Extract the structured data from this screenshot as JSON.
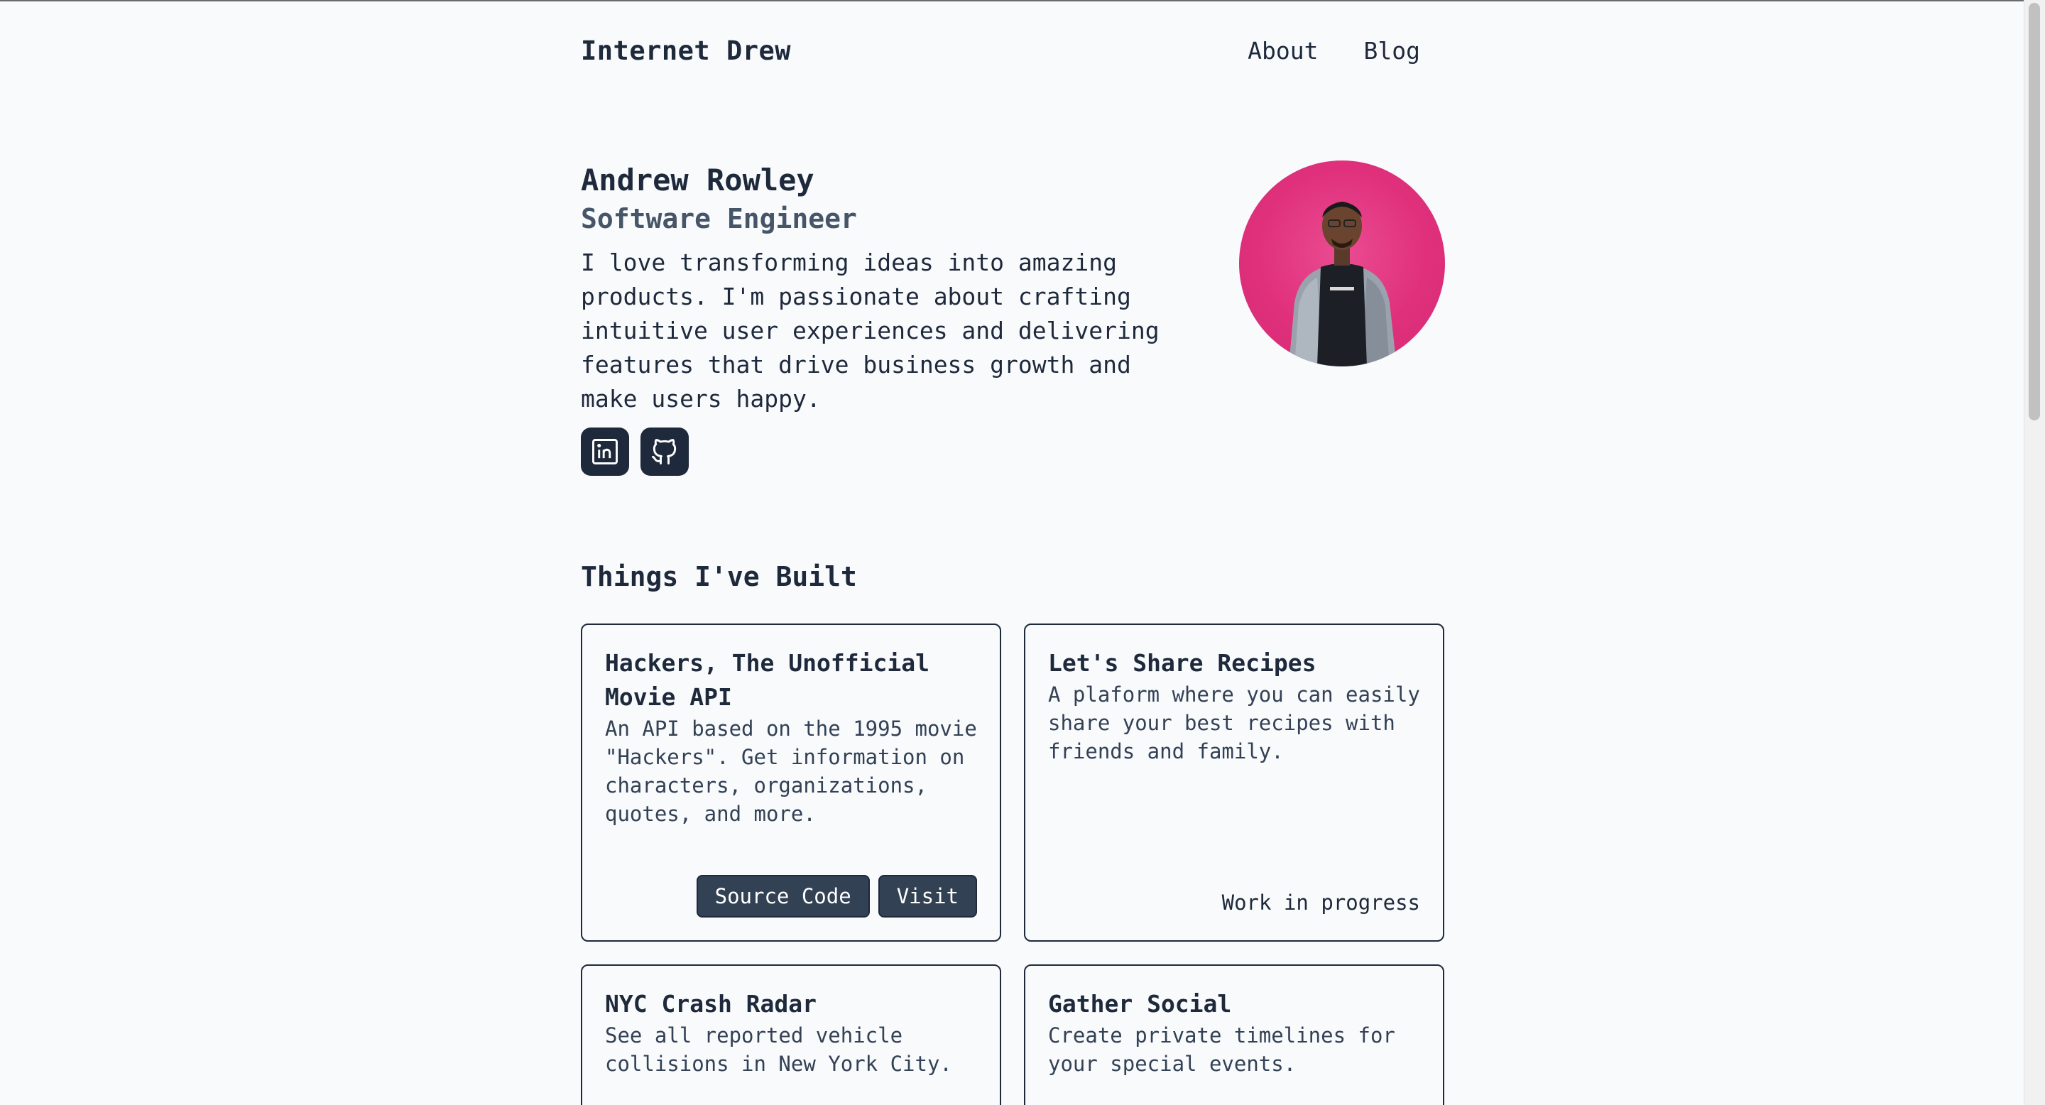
{
  "header": {
    "site_name": "Internet Drew",
    "nav": [
      "About",
      "Blog"
    ]
  },
  "intro": {
    "name": "Andrew Rowley",
    "role": "Software Engineer",
    "bio": "I love transforming ideas into amazing products. I'm passionate about crafting intuitive user experiences and delivering features that drive business growth and make users happy.",
    "socials": [
      {
        "icon": "linkedin-icon"
      },
      {
        "icon": "github-icon"
      }
    ]
  },
  "projects_section": {
    "title": "Things I've Built",
    "projects": [
      {
        "title": "Hackers, The Unofficial Movie API",
        "description": "An API based on the 1995 movie \"Hackers\". Get information on characters, organizations, quotes, and more.",
        "source_label": "Source Code",
        "visit_label": "Visit"
      },
      {
        "title": "Let's Share Recipes",
        "description": "A plaform where you can easily share your best recipes with friends and family.",
        "status": "Work in progress"
      },
      {
        "title": "NYC Crash Radar",
        "description": "See all reported vehicle collisions in New York City."
      },
      {
        "title": "Gather Social",
        "description": "Create private timelines for your special events."
      }
    ]
  },
  "colors": {
    "background": "#f8fafc",
    "text": "#1e293b",
    "button": "#334155",
    "avatar_bg": "#e0307c"
  }
}
